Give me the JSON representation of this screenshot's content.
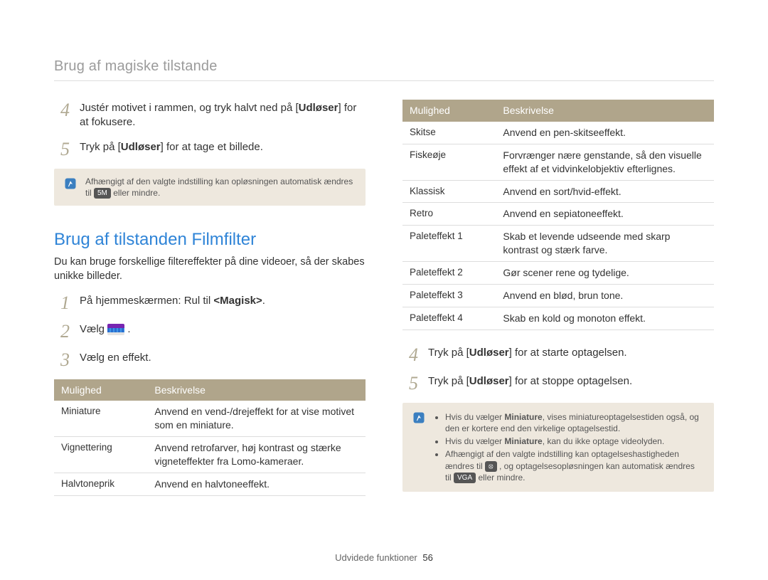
{
  "breadcrumb": "Brug af magiske tilstande",
  "left": {
    "steps_top": [
      {
        "num": "4",
        "html": "Justér motivet i rammen, og tryk halvt ned på [<b>Udløser</b>] for at fokusere."
      },
      {
        "num": "5",
        "html": "Tryk på [<b>Udløser</b>] for at tage et billede."
      }
    ],
    "note_top": {
      "icon": "note-icon",
      "text_pre": "Afhængigt af den valgte indstilling kan opløsningen automatisk ændres til ",
      "badge": "5M",
      "text_post": " eller mindre."
    },
    "section": {
      "title": "Brug af tilstanden Filmfilter",
      "desc": "Du kan bruge forskellige filtereffekter på dine videoer, så der skabes unikke billeder.",
      "steps": [
        {
          "num": "1",
          "html": "På hjemmeskærmen: Rul til <b>&lt;Magisk&gt;</b>."
        },
        {
          "num": "2",
          "html": "Vælg <span class='icon-img' data-name='filmfilter-mode-icon' data-interactable='false'></span> ."
        },
        {
          "num": "3",
          "html": "Vælg en effekt."
        }
      ],
      "table": {
        "head": [
          "Mulighed",
          "Beskrivelse"
        ],
        "rows": [
          [
            "Miniature",
            "Anvend en vend-/drejeffekt for at vise motivet som en miniature."
          ],
          [
            "Vignettering",
            "Anvend retrofarver, høj kontrast og stærke vigneteffekter fra Lomo-kameraer."
          ],
          [
            "Halvtoneprik",
            "Anvend en halvtoneeffekt."
          ]
        ]
      }
    }
  },
  "right": {
    "table": {
      "head": [
        "Mulighed",
        "Beskrivelse"
      ],
      "rows": [
        [
          "Skitse",
          "Anvend en pen-skitseeffekt."
        ],
        [
          "Fiskeøje",
          "Forvrænger nære genstande, så den visuelle effekt af et vidvinkelobjektiv efterlignes."
        ],
        [
          "Klassisk",
          "Anvend en sort/hvid-effekt."
        ],
        [
          "Retro",
          "Anvend en sepiatoneeffekt."
        ],
        [
          "Paleteffekt 1",
          "Skab et levende udseende med skarp kontrast og stærk farve."
        ],
        [
          "Paleteffekt 2",
          "Gør scener rene og tydelige."
        ],
        [
          "Paleteffekt 3",
          "Anvend en blød, brun tone."
        ],
        [
          "Paleteffekt 4",
          "Skab en kold og monoton effekt."
        ]
      ]
    },
    "steps": [
      {
        "num": "4",
        "html": "Tryk på [<b>Udløser</b>] for at starte optagelsen."
      },
      {
        "num": "5",
        "html": "Tryk på [<b>Udløser</b>] for at stoppe optagelsen."
      }
    ],
    "note": {
      "icon": "note-icon",
      "items": [
        "Hvis du vælger <b>Miniature</b>, vises miniatureoptagelsestiden også, og den er kortere end den virkelige optagelsestid.",
        "Hvis du vælger <b>Miniature</b>, kan du ikke optage videolyden.",
        "__complex__"
      ],
      "complex_item": {
        "pre": "Afhængigt af den valgte indstilling kan optagelseshastigheden ændres til ",
        "badge_a": "⦻",
        "mid": " , og optagelsesopløsningen kan automatisk ændres til ",
        "badge_b": "VGA",
        "post": " eller mindre."
      }
    }
  },
  "footer": {
    "label": "Udvidede funktioner",
    "page": "56"
  }
}
